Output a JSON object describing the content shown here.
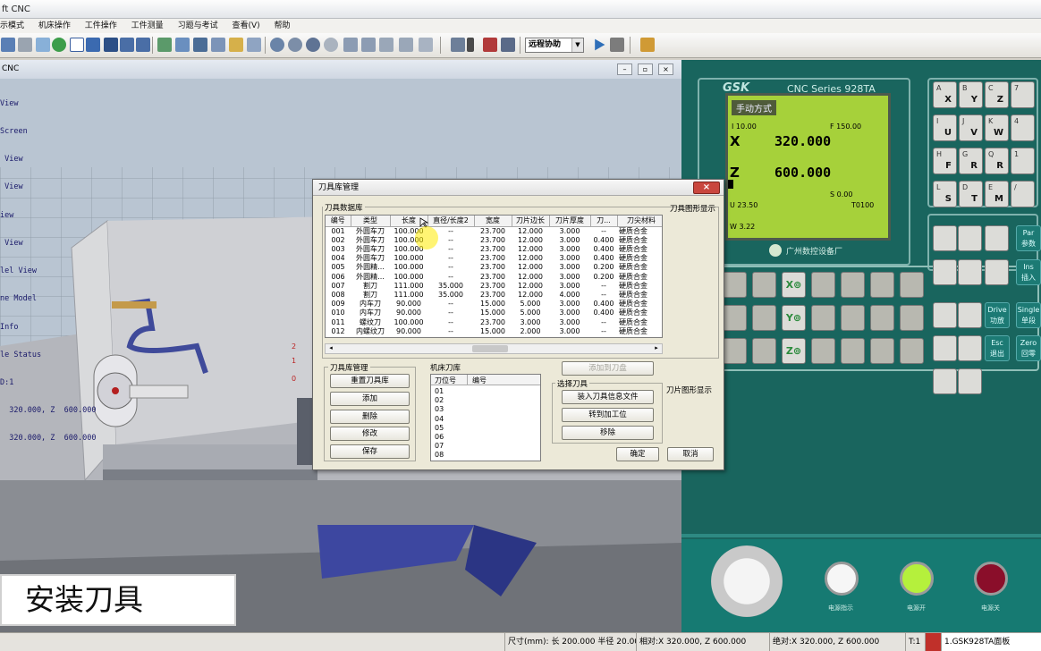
{
  "app": {
    "title": "ft CNC"
  },
  "menu": [
    "示模式",
    "机床操作",
    "工件操作",
    "工件测量",
    "习题与考试",
    "查看(V)",
    "帮助"
  ],
  "toolbar": {
    "remote_label": "远程协助"
  },
  "viewport": {
    "title": "CNC",
    "lines": [
      "View",
      "Screen",
      " View",
      " View",
      "iew",
      " View",
      "lel View",
      "ne Model",
      "Info",
      "le Status",
      "D:1",
      "  320.000, Z  600.000",
      "  320.000, Z  600.000"
    ],
    "ruler_marks": [
      "2",
      "1",
      "0"
    ]
  },
  "caption": "安装刀具",
  "status": {
    "size": "尺寸(mm): 长 200.000 半径  20.000",
    "rel": "相对:X  320.000, Z  600.000",
    "abs": "绝对:X  320.000, Z  600.000",
    "tool": "T:1",
    "panel": "1.GSK928TA面板"
  },
  "cnc": {
    "brand": "GSK",
    "series": "CNC Series  928TA",
    "mode": "手动方式",
    "i_value": "I 10.00",
    "f_value": "F 150.00",
    "x_label": "X",
    "x_value": "320.000",
    "z_label": "Z",
    "z_value": "600.000",
    "s_value": "S  0.00",
    "u_value": "U      23.50",
    "t_value": "T0100",
    "w_value": "W      3.22",
    "maker": "广州数控设备厂",
    "keys": [
      {
        "a": "A",
        "b": "X"
      },
      {
        "a": "B",
        "b": "Y"
      },
      {
        "a": "C",
        "b": "Z"
      },
      {
        "a": "7",
        "b": ""
      },
      {
        "a": "I",
        "b": "U"
      },
      {
        "a": "J",
        "b": "V"
      },
      {
        "a": "K",
        "b": "W"
      },
      {
        "a": "4",
        "b": ""
      },
      {
        "a": "H",
        "b": "F"
      },
      {
        "a": "G",
        "b": "R"
      },
      {
        "a": "Q",
        "b": "R"
      },
      {
        "a": "1",
        "b": ""
      },
      {
        "a": "L",
        "b": "S"
      },
      {
        "a": "D",
        "b": "T"
      },
      {
        "a": "E",
        "b": "M"
      },
      {
        "a": "/",
        "b": ""
      }
    ],
    "right_keys": [
      {
        "en": "Par",
        "cn": "参数"
      },
      {
        "en": "Ins",
        "cn": "插入"
      },
      {
        "en": "Drive",
        "cn": "功放"
      },
      {
        "en": "Single",
        "cn": "单段"
      },
      {
        "en": "Esc",
        "cn": "退出"
      },
      {
        "en": "Zero",
        "cn": "回零"
      }
    ],
    "axis_keys": [
      "X⊚",
      "Y⊚",
      "Z⊚"
    ],
    "lamps": [
      "电源指示",
      "电源开",
      "电源关"
    ],
    "colors": {
      "panel": "#19655e",
      "screen": "#a6d13a",
      "lamp_on": "#b5f03c",
      "lamp_off": "#8a0e2a"
    }
  },
  "dialog": {
    "title": "刀具库管理",
    "db_label": "刀具数据库",
    "graph_label": "刀具图形显示",
    "graph_label2": "刀片图形显示",
    "columns": [
      "编号",
      "类型",
      "长度",
      "直径/长度2",
      "宽度",
      "刀片边长",
      "刀片厚度",
      "刀...",
      "刀尖材料"
    ],
    "rows": [
      [
        "001",
        "外圆车刀",
        "100.000",
        "--",
        "23.700",
        "12.000",
        "3.000",
        "--",
        "硬质合金"
      ],
      [
        "002",
        "外圆车刀",
        "100.000",
        "--",
        "23.700",
        "12.000",
        "3.000",
        "0.400",
        "硬质合金"
      ],
      [
        "003",
        "外圆车刀",
        "100.000",
        "--",
        "23.700",
        "12.000",
        "3.000",
        "0.400",
        "硬质合金"
      ],
      [
        "004",
        "外圆车刀",
        "100.000",
        "--",
        "23.700",
        "12.000",
        "3.000",
        "0.400",
        "硬质合金"
      ],
      [
        "005",
        "外圆精...",
        "100.000",
        "--",
        "23.700",
        "12.000",
        "3.000",
        "0.200",
        "硬质合金"
      ],
      [
        "006",
        "外圆精...",
        "100.000",
        "--",
        "23.700",
        "12.000",
        "3.000",
        "0.200",
        "硬质合金"
      ],
      [
        "007",
        "割刀",
        "111.000",
        "35.000",
        "23.700",
        "12.000",
        "3.000",
        "--",
        "硬质合金"
      ],
      [
        "008",
        "割刀",
        "111.000",
        "35.000",
        "23.700",
        "12.000",
        "4.000",
        "--",
        "硬质合金"
      ],
      [
        "009",
        "内车刀",
        "90.000",
        "--",
        "15.000",
        "5.000",
        "3.000",
        "0.400",
        "硬质合金"
      ],
      [
        "010",
        "内车刀",
        "90.000",
        "--",
        "15.000",
        "5.000",
        "3.000",
        "0.400",
        "硬质合金"
      ],
      [
        "011",
        "螺纹刀",
        "100.000",
        "--",
        "23.700",
        "3.000",
        "3.000",
        "--",
        "硬质合金"
      ],
      [
        "012",
        "内螺纹刀",
        "90.000",
        "--",
        "15.000",
        "2.000",
        "3.000",
        "--",
        "硬质合金"
      ]
    ],
    "mgmt_label": "刀具库管理",
    "mgmt_buttons": [
      "重置刀具库",
      "添加",
      "删除",
      "修改",
      "保存"
    ],
    "machine_label": "机床刀库",
    "slot_cols": [
      "刀位号",
      "编号"
    ],
    "slots": [
      "01",
      "02",
      "03",
      "04",
      "05",
      "06",
      "07",
      "08"
    ],
    "add_to_disk": "添加到刀盘",
    "select_label": "选择刀具",
    "select_buttons": [
      "装入刀具信息文件",
      "转到加工位",
      "移除"
    ],
    "ok": "确定",
    "cancel": "取消"
  }
}
